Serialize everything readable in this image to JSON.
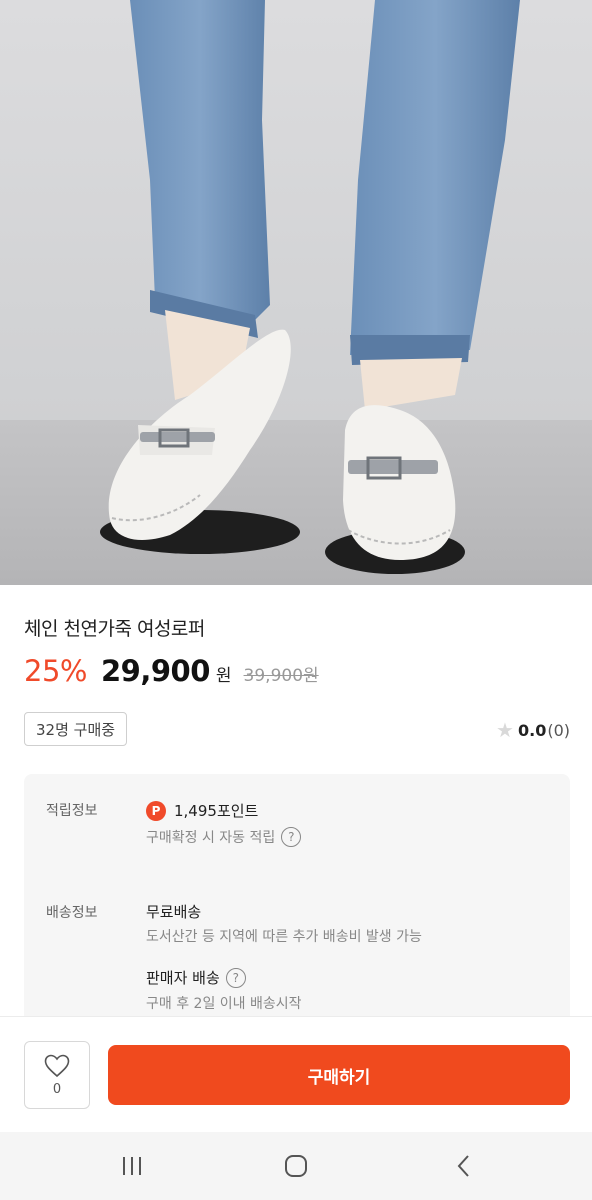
{
  "product": {
    "title": "체인 천연가죽 여성로퍼",
    "discount": "25%",
    "price": "29,900",
    "currency": "원",
    "original_price": "39,900원"
  },
  "social": {
    "buying_badge": "32명 구매중",
    "rating_value": "0.0",
    "rating_count": "(0)"
  },
  "info": {
    "points_label": "적립정보",
    "points_icon": "P",
    "points_value": "1,495포인트",
    "points_sub": "구매확정 시 자동 적립",
    "shipping_label": "배송정보",
    "shipping_value": "무료배송",
    "shipping_sub": "도서산간 등 지역에 따른 추가 배송비 발생 가능",
    "seller_shipping": "판매자 배송",
    "seller_shipping_sub": "구매 후 2일 이내 배송시작"
  },
  "actions": {
    "like_count": "0",
    "buy_label": "구매하기"
  },
  "colors": {
    "accent": "#f04a1e",
    "discount": "#f04a2a"
  }
}
